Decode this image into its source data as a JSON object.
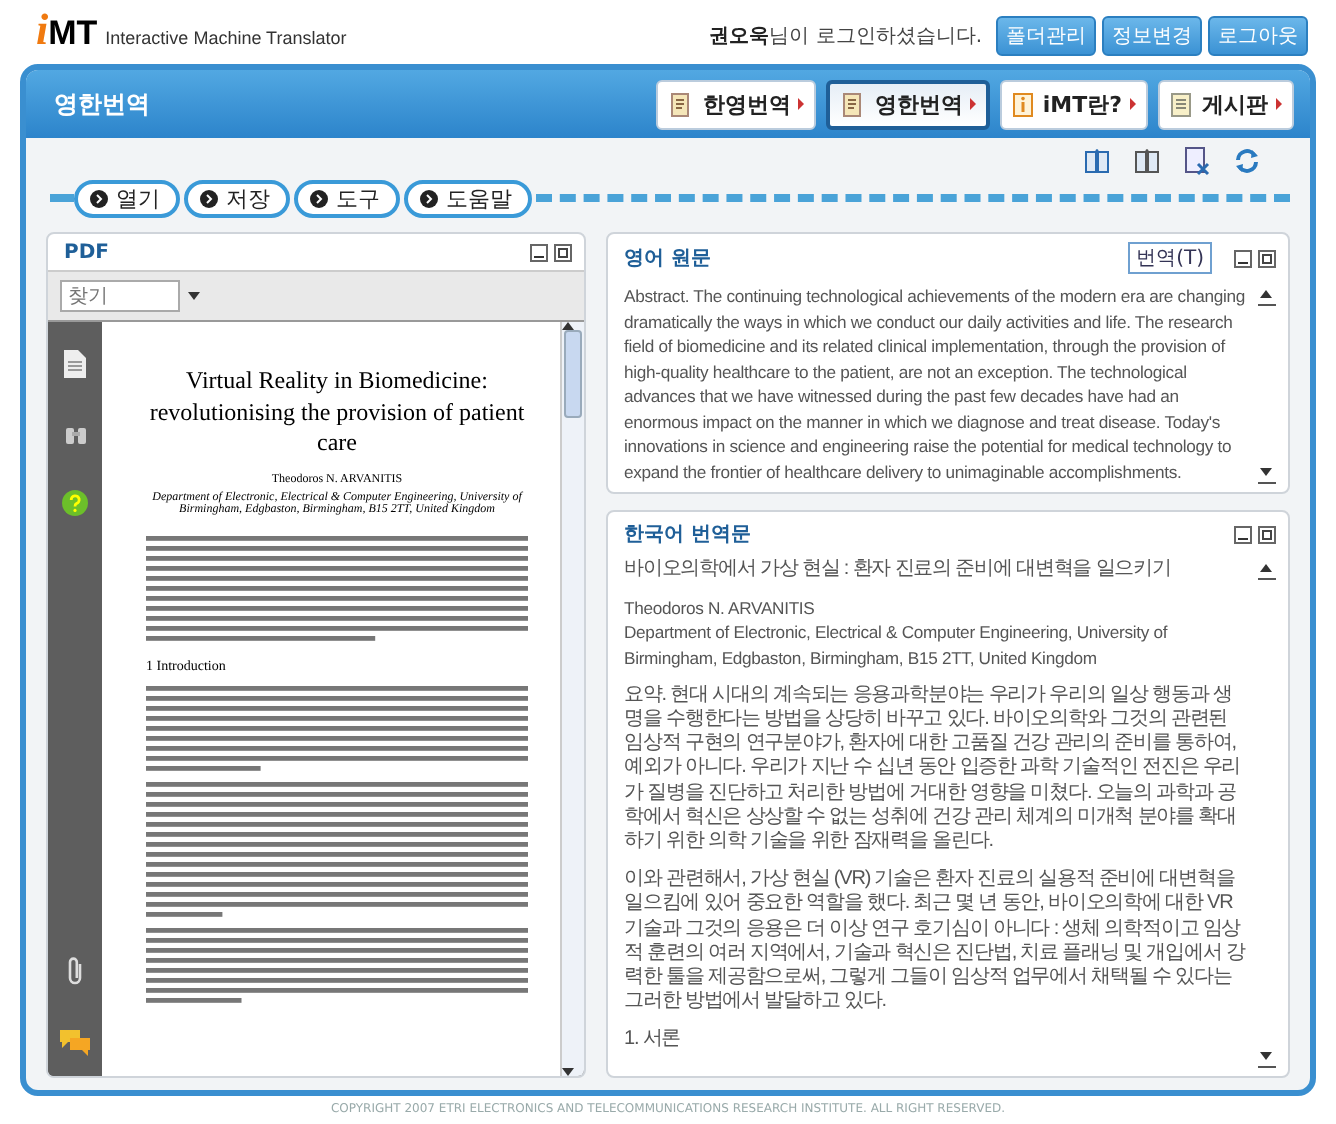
{
  "header": {
    "logo_mark": "i",
    "logo": "MT",
    "tagline": "Interactive Machine Translator",
    "login_message": "**권오욱**님이 로그인하셨습니다.",
    "buttons": [
      "폴더관리",
      "정보변경",
      "로그아웃"
    ]
  },
  "title_bar": {
    "title": "영한번역",
    "nav": [
      {
        "label": "한영번역",
        "selected": false
      },
      {
        "label": "영한번역",
        "selected": true
      },
      {
        "label": "iMT란?",
        "selected": false
      },
      {
        "label": "게시판",
        "selected": false
      }
    ]
  },
  "toolbar": {
    "buttons": [
      "열기",
      "저장",
      "도구",
      "도움말"
    ]
  },
  "pdf_panel": {
    "title": "PDF",
    "search": {
      "placeholder": "찾기"
    },
    "document": {
      "title": "Virtual Reality in Biomedicine: revolutionising the provision of patient care",
      "author": "Theodoros N. ARVANITIS",
      "affiliation": "Department of Electronic, Electrical & Computer Engineering, University of Birmingham, Edgbaston, Birmingham, B15 2TT, United Kingdom",
      "section_heading": "1 Introduction"
    }
  },
  "source_panel": {
    "title": "영어 원문",
    "translate_button": "번역(T)",
    "text": "Abstract. The continuing technological achievements of the modern era are changing dramatically the ways in which we conduct our daily activities and life. The research field of biomedicine and its related clinical implementation, through the provision of high-quality healthcare to the patient, are not an exception. The technological advances that we have witnessed during the past few decades have had an enormous impact on the manner in which we diagnose and treat disease. Today's innovations in science and engineering raise the potential for medical technology to expand the frontier of healthcare delivery to unimaginable accomplishments."
  },
  "target_panel": {
    "title": "한국어 번역문",
    "paragraphs": [
      "바이오의학에서 가상 현실 :  환자 진료의 준비에 대변혁을 일으키기",
      "Theodoros N. ARVANITIS\nDepartment of Electronic, Electrical & Computer Engineering, University of Birmingham, Edgbaston, Birmingham, B15 2TT, United Kingdom",
      "요약.  현대 시대의 계속되는 응용과학분야는 우리가 우리의 일상 행동과 생명을 수행한다는 방법을 상당히 바꾸고 있다.  바이오의학와 그것의 관련된 임상적 구현의 연구분야가, 환자에 대한 고품질 건강 관리의 준비를 통하여, 예외가 아니다.  우리가 지난 수 십년 동안 입증한 과학 기술적인 전진은 우리가 질병을 진단하고 처리한 방법에 거대한 영향을 미쳤다.  오늘의 과학과 공학에서 혁신은 상상할 수 없는 성취에 건강 관리 체계의 미개척 분야를 확대하기 위한 의학 기술을 위한 잠재력을 올린다.",
      "이와 관련해서, 가상 현실 (VR) 기술은 환자 진료의 실용적 준비에 대변혁을 일으킴에 있어 중요한 역할을 했다.  최근 몇 년 동안, 바이오의학에 대한 VR 기술과 그것의 응용은 더 이상 연구 호기심이 아니다 :  생체 의학적이고 임상적 훈련의 여러 지역에서, 기술과 혁신은 진단법, 치료 플래닝 및 개입에서 강력한 툴을 제공함으로써, 그렇게 그들이 임상적 업무에서 채택될 수 있다는 그러한 방법에서 발달하고 있다.",
      "1.  서론"
    ]
  },
  "footer": "COPYRIGHT  2007  ETRI  ELECTRONICS AND TELECOMMUNICATIONS RESEARCH INSTITUTE. ALL RIGHT RESERVED."
}
